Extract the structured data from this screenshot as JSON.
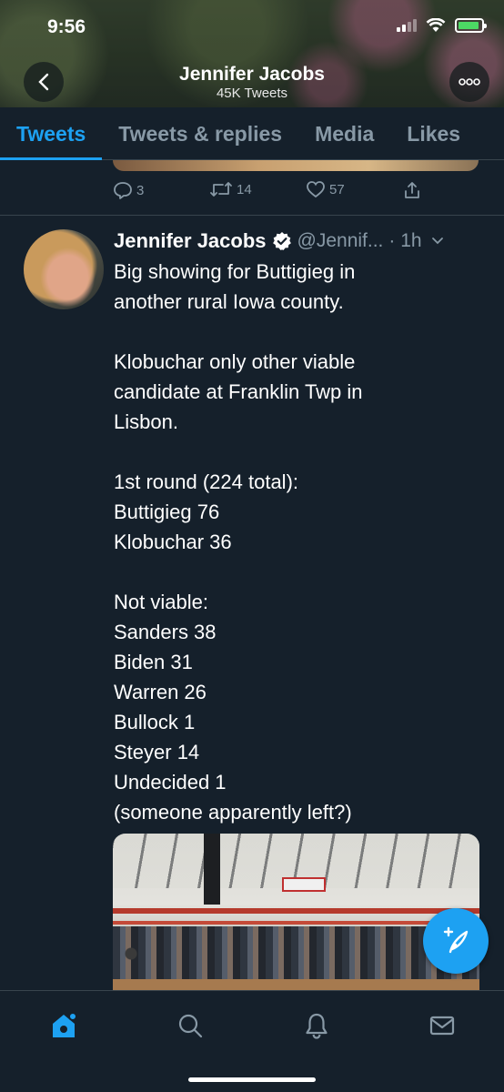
{
  "status_bar": {
    "time": "9:56"
  },
  "profile_header": {
    "name": "Jennifer Jacobs",
    "tweet_count": "45K Tweets"
  },
  "tabs": [
    {
      "label": "Tweets",
      "active": true
    },
    {
      "label": "Tweets & replies",
      "active": false
    },
    {
      "label": "Media",
      "active": false
    },
    {
      "label": "Likes",
      "active": false
    }
  ],
  "previous_tweet": {
    "replies": "3",
    "retweets": "14",
    "likes": "57"
  },
  "tweet": {
    "author_name": "Jennifer Jacobs",
    "handle": "@Jennif...",
    "time": "· 1h",
    "text_lines": [
      "Big showing for Buttigieg in",
      "another rural Iowa county.",
      "",
      "Klobuchar only other viable",
      "candidate at Franklin Twp in",
      "Lisbon.",
      "",
      "1st round (224 total):",
      "Buttigieg 76",
      "Klobuchar 36",
      "",
      "Not viable:",
      "Sanders 38",
      "Biden 31",
      "Warren 26",
      "Bullock 1",
      "Steyer 14",
      "Undecided 1",
      "(someone apparently left?)"
    ]
  },
  "colors": {
    "background": "#15202b",
    "accent": "#1da1f2",
    "secondary_text": "#8899a6",
    "divider": "#38444d"
  },
  "icons": {
    "back": "chevron-left-icon",
    "more": "ellipsis-icon",
    "reply": "reply-icon",
    "retweet": "retweet-icon",
    "like": "heart-icon",
    "share": "share-icon",
    "verified": "verified-badge-icon",
    "caret": "chevron-down-icon",
    "compose": "compose-tweet-icon",
    "home": "home-icon",
    "search": "search-icon",
    "notifications": "bell-icon",
    "messages": "mail-icon"
  }
}
